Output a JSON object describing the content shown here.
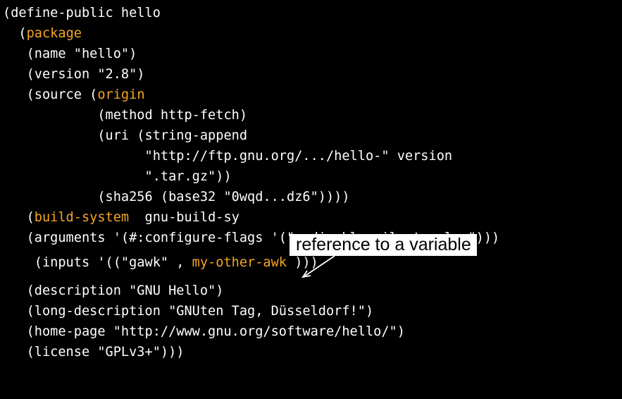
{
  "code": {
    "lines": [
      [
        {
          "t": "(define-public hello",
          "c": "plain"
        }
      ],
      [
        {
          "t": "  (",
          "c": "plain"
        },
        {
          "t": "package",
          "c": "kw"
        }
      ],
      [
        {
          "t": "   (name \"hello\")",
          "c": "plain"
        }
      ],
      [
        {
          "t": "   (version \"2.8\")",
          "c": "plain"
        }
      ],
      [
        {
          "t": "   (source (",
          "c": "plain"
        },
        {
          "t": "origin",
          "c": "kw"
        }
      ],
      [
        {
          "t": "            (method http-fetch)",
          "c": "plain"
        }
      ],
      [
        {
          "t": "            (uri (string-append",
          "c": "plain"
        }
      ],
      [
        {
          "t": "                  \"http://ftp.gnu.org/.../hello-\" version",
          "c": "plain"
        }
      ],
      [
        {
          "t": "                  \".tar.gz\"))",
          "c": "plain"
        }
      ],
      [
        {
          "t": "            (sha256 (base32 \"0wqd...dz6\"))))",
          "c": "plain"
        }
      ],
      [
        {
          "t": "   (",
          "c": "plain"
        },
        {
          "t": "build-system",
          "c": "kw"
        },
        {
          "t": "  gnu-build-sy",
          "c": "plain"
        }
      ],
      [
        {
          "t": "   (arguments '(#:configure-flags '(\"--disable-silent-rules\")))",
          "c": "plain"
        }
      ],
      [
        {
          "t": "    (inputs '((\"gawk\" , ",
          "c": "plain"
        },
        {
          "t": "my-other-awk",
          "c": "var"
        },
        {
          "t": " )))",
          "c": "plain"
        }
      ],
      [
        {
          "t": "   (description \"GNU Hello\")",
          "c": "plain"
        }
      ],
      [
        {
          "t": "   (long-description \"GNUten Tag, Düsseldorf!\")",
          "c": "plain"
        }
      ],
      [
        {
          "t": "   (home-page \"http://www.gnu.org/software/hello/\")",
          "c": "plain"
        }
      ],
      [
        {
          "t": "   (license \"GPLv3+\")))",
          "c": "plain"
        }
      ]
    ]
  },
  "callout": {
    "text": "reference to a variable"
  },
  "colors": {
    "background": "#000000",
    "text": "#ffffff",
    "keyword": "#f5a623",
    "callout_bg": "#ffffff",
    "callout_text": "#000000"
  }
}
